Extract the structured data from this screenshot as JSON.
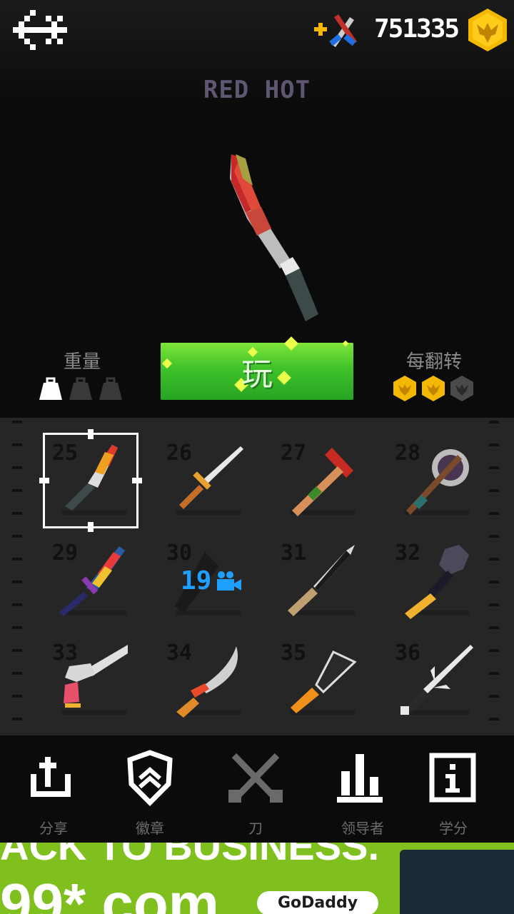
{
  "header": {
    "back_icon": "back-arrow-icon",
    "add_weapon_icon": "add-weapon-icon",
    "coins": "751335",
    "coin_icon": "gold-eagle-coin-icon"
  },
  "selected_knife": {
    "name": "RED HOT",
    "weight_label": "重量",
    "weight_level": 1,
    "weight_max": 3,
    "flip_label": "每翻转",
    "flip_reward": 2,
    "flip_reward_max": 3
  },
  "play_button": {
    "label": "玩"
  },
  "knives": [
    {
      "number": "25",
      "selected": true
    },
    {
      "number": "26",
      "selected": false
    },
    {
      "number": "27",
      "selected": false
    },
    {
      "number": "28",
      "selected": false
    },
    {
      "number": "29",
      "selected": false
    },
    {
      "number": "30",
      "selected": false,
      "locked_video_count": "19"
    },
    {
      "number": "31",
      "selected": false
    },
    {
      "number": "32",
      "selected": false
    },
    {
      "number": "33",
      "selected": false
    },
    {
      "number": "34",
      "selected": false
    },
    {
      "number": "35",
      "selected": false
    },
    {
      "number": "36",
      "selected": false
    }
  ],
  "bottom_nav": [
    {
      "label": "分享",
      "icon": "share-icon"
    },
    {
      "label": "徽章",
      "icon": "badge-icon"
    },
    {
      "label": "刀",
      "icon": "knives-icon"
    },
    {
      "label": "领导者",
      "icon": "leaderboard-icon"
    },
    {
      "label": "学分",
      "icon": "info-icon"
    }
  ],
  "ad": {
    "line1": "ACK TO BUSINESS.",
    "line2": "99* com",
    "logo": "GoDaddy"
  },
  "colors": {
    "accent_green": "#3fc22a",
    "knife_name": "#5f5672",
    "coin_gold": "#f5b800",
    "video_blue": "#1ea0ff"
  }
}
